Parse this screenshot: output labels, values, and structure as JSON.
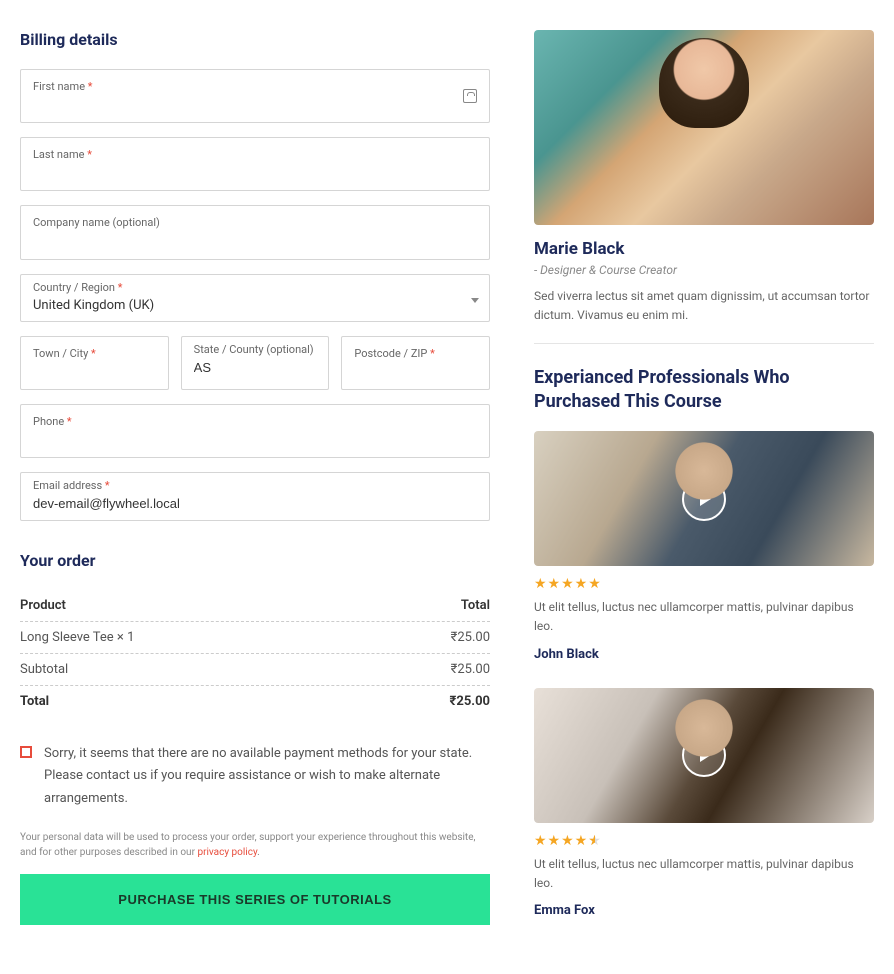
{
  "billing": {
    "title": "Billing details",
    "fields": {
      "first_name": {
        "label": "First name",
        "required": true
      },
      "last_name": {
        "label": "Last name",
        "required": true
      },
      "company": {
        "label": "Company name (optional)",
        "required": false
      },
      "country": {
        "label": "Country / Region",
        "required": true,
        "value": "United Kingdom (UK)"
      },
      "city": {
        "label": "Town / City",
        "required": true
      },
      "state": {
        "label": "State / County (optional)",
        "required": false,
        "value": "AS"
      },
      "postcode": {
        "label": "Postcode / ZIP",
        "required": true
      },
      "phone": {
        "label": "Phone",
        "required": true
      },
      "email": {
        "label": "Email address",
        "required": true,
        "value": "dev-email@flywheel.local"
      }
    }
  },
  "order": {
    "title": "Your order",
    "header_product": "Product",
    "header_total": "Total",
    "item_name": "Long Sleeve Tee  × 1",
    "item_total": "₹25.00",
    "subtotal_label": "Subtotal",
    "subtotal_value": "₹25.00",
    "total_label": "Total",
    "total_value": "₹25.00"
  },
  "notice": "Sorry, it seems that there are no available payment methods for your state. Please contact us if you require assistance or wish to make alternate arrangements.",
  "privacy_text": "Your personal data will be used to process your order, support your experience throughout this website, and for other purposes described in our ",
  "privacy_link": "privacy policy",
  "purchase_button": "PURCHASE THIS SERIES OF TUTORIALS",
  "instructor": {
    "name": "Marie Black",
    "role": "- Designer & Course Creator",
    "bio": "Sed viverra lectus sit amet quam dignissim, ut accumsan tortor dictum. Vivamus eu enim mi."
  },
  "experts_title": "Experianced Professionals Who Purchased This Course",
  "testimonials": [
    {
      "rating_type": "full",
      "text": "Ut elit tellus, luctus nec ullamcorper mattis, pulvinar dapibus leo.",
      "name": "John Black"
    },
    {
      "rating_type": "half",
      "text": "Ut elit tellus, luctus nec ullamcorper mattis, pulvinar dapibus leo.",
      "name": "Emma Fox"
    }
  ]
}
